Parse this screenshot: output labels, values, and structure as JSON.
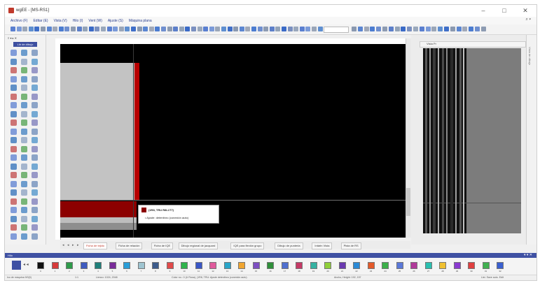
{
  "window": {
    "title": "wgEE - [MS-RS1]",
    "minimize": "–",
    "maximize": "□",
    "close": "✕"
  },
  "menu": {
    "items": [
      "Archivo (F)",
      "Editar (E)",
      "Vista (V)",
      "Hilo (I)",
      "Vent (W)",
      "Ajuste (S)",
      "Máquina plana"
    ],
    "right": "⌕ ▾"
  },
  "toolbar": {
    "zoom_value": ""
  },
  "palette": {
    "title": "≡ ▾ ▸ ✕",
    "tab": "Lib de dibujo"
  },
  "canvas": {
    "popup": {
      "title": "(1R8, TRU R8L1T7)",
      "text": "• Ajuste: detenitnro (conexión auto)"
    },
    "tabs": [
      {
        "label": "Ficha de tejido",
        "active": true
      },
      {
        "label": "Ficha de relación",
        "active": false
      },
      {
        "label": "Ficha de IQE",
        "active": false
      },
      {
        "label": "Dibujo regional de jacquard",
        "active": false
      },
      {
        "label": "IQE para flexión grupo",
        "active": false
      },
      {
        "label": "Dibujo de punteria",
        "active": false
      },
      {
        "label": "Intárin Vista",
        "active": false
      },
      {
        "label": "Pista de RS",
        "active": false
      }
    ],
    "tab_nav": [
      "◂",
      "◂",
      "▸",
      "▸"
    ]
  },
  "right_panel": {
    "title": "Vista Pr",
    "edge_label": "Vista de dibujo"
  },
  "color_bar": {
    "label": "Hilo",
    "controls": "▾ ▾ ✕",
    "swatches": [
      {
        "num": "0",
        "color": "#101010"
      },
      {
        "num": "1",
        "color": "#d63a3a"
      },
      {
        "num": "2",
        "color": "#2e9a4a"
      },
      {
        "num": "3",
        "color": "#3f5bbf"
      },
      {
        "num": "4",
        "color": "#1f7f7a"
      },
      {
        "num": "5",
        "color": "#7a2c9a"
      },
      {
        "num": "6",
        "color": "#2a9ed8"
      },
      {
        "num": "7",
        "color": "#9ec4d0"
      },
      {
        "num": "8",
        "color": "#3c5a8a"
      },
      {
        "num": "9",
        "color": "#e14a4a"
      },
      {
        "num": "10",
        "color": "#2fb34c"
      },
      {
        "num": "11",
        "color": "#3a57c6"
      },
      {
        "num": "12",
        "color": "#e05a9c"
      },
      {
        "num": "13",
        "color": "#2aa5c8"
      },
      {
        "num": "14",
        "color": "#f0a530"
      },
      {
        "num": "15",
        "color": "#7d4fc1"
      },
      {
        "num": "16",
        "color": "#2f8f3a"
      },
      {
        "num": "17",
        "color": "#4f6fcf"
      },
      {
        "num": "18",
        "color": "#c43a66"
      },
      {
        "num": "19",
        "color": "#35b2a2"
      },
      {
        "num": "20",
        "color": "#8fcf3a"
      },
      {
        "num": "21",
        "color": "#6a3ab0"
      },
      {
        "num": "22",
        "color": "#2b8ad6"
      },
      {
        "num": "23",
        "color": "#e45a2a"
      },
      {
        "num": "24",
        "color": "#3cb04a"
      },
      {
        "num": "25",
        "color": "#5a78d8"
      },
      {
        "num": "26",
        "color": "#b03a9a"
      },
      {
        "num": "27",
        "color": "#2ac0b0"
      },
      {
        "num": "28",
        "color": "#f0c030"
      },
      {
        "num": "29",
        "color": "#8a3ad0"
      },
      {
        "num": "30",
        "color": "#e04040"
      },
      {
        "num": "31",
        "color": "#40b050"
      },
      {
        "num": "32",
        "color": "#3a60d0"
      }
    ]
  },
  "status": {
    "left": "Ico de máquina 9/0(0)",
    "pos": "1:1",
    "dims": "Lienzo: 1024, 2048",
    "info": "Color no.: 0 (U Rosa), (1R8, TRU: Ajuste detenitnro (conexión auto)",
    "size": "Ancho, Height: 192, 157",
    "right": "List. Save auto. Edit"
  }
}
